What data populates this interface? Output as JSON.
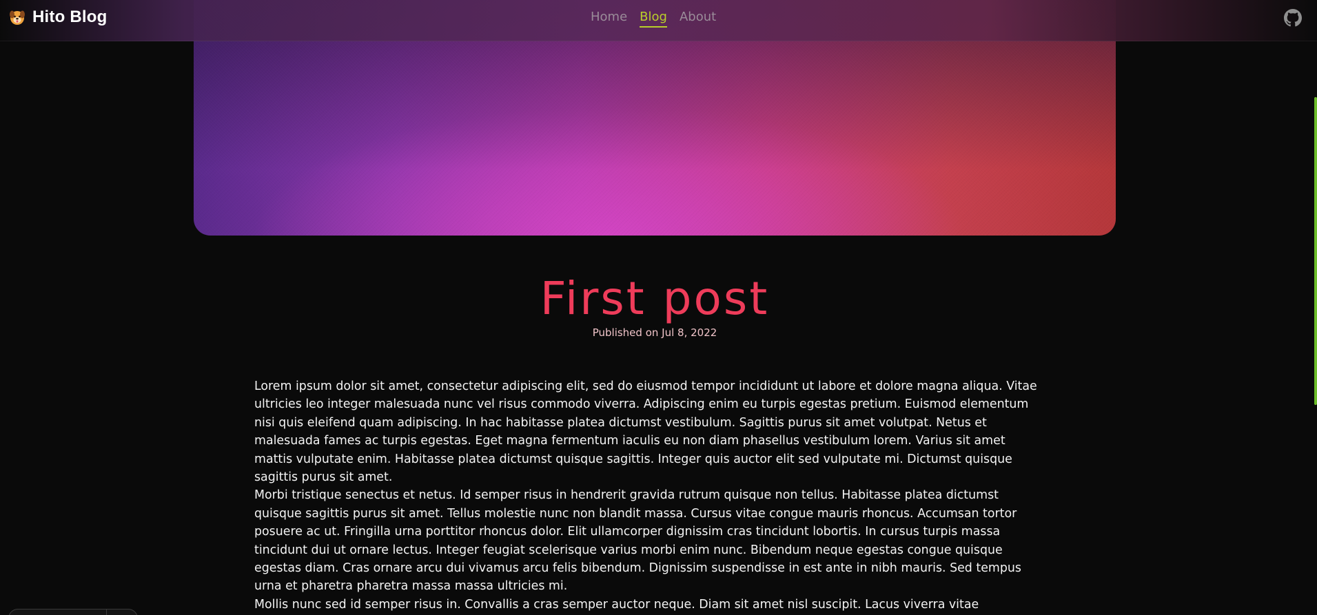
{
  "brand": {
    "name": "Hito Blog",
    "logo_icon": "dog-face-icon"
  },
  "nav": {
    "links": [
      {
        "label": "Home",
        "active": false
      },
      {
        "label": "Blog",
        "active": true
      },
      {
        "label": "About",
        "active": false
      }
    ],
    "github_icon": "github-icon"
  },
  "colors": {
    "accent_active": "#b9cf2a",
    "title": "#ee3c5a",
    "scroll_progress": "#6dbd2a"
  },
  "post": {
    "title": "First post",
    "meta": "Published on Jul 8, 2022",
    "paragraphs": [
      "Lorem ipsum dolor sit amet, consectetur adipiscing elit, sed do eiusmod tempor incididunt ut labore et dolore magna aliqua. Vitae ultricies leo integer malesuada nunc vel risus commodo viverra. Adipiscing enim eu turpis egestas pretium. Euismod elementum nisi quis eleifend quam adipiscing. In hac habitasse platea dictumst vestibulum. Sagittis purus sit amet volutpat. Netus et malesuada fames ac turpis egestas. Eget magna fermentum iaculis eu non diam phasellus vestibulum lorem. Varius sit amet mattis vulputate enim. Habitasse platea dictumst quisque sagittis. Integer quis auctor elit sed vulputate mi. Dictumst quisque sagittis purus sit amet.",
      "Morbi tristique senectus et netus. Id semper risus in hendrerit gravida rutrum quisque non tellus. Habitasse platea dictumst quisque sagittis purus sit amet. Tellus molestie nunc non blandit massa. Cursus vitae congue mauris rhoncus. Accumsan tortor posuere ac ut. Fringilla urna porttitor rhoncus dolor. Elit ullamcorper dignissim cras tincidunt lobortis. In cursus turpis massa tincidunt dui ut ornare lectus. Integer feugiat scelerisque varius morbi enim nunc. Bibendum neque egestas congue quisque egestas diam. Cras ornare arcu dui vivamus arcu felis bibendum. Dignissim suspendisse in est ante in nibh mauris. Sed tempus urna et pharetra pharetra massa massa ultricies mi.",
      "Mollis nunc sed id semper risus in. Convallis a cras semper auctor neque. Diam sit amet nisl suscipit. Lacus viverra vitae"
    ]
  }
}
